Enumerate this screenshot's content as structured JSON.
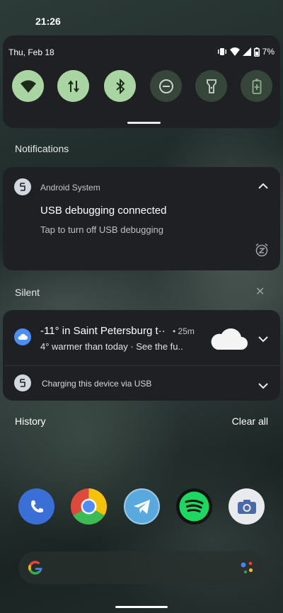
{
  "status_bar": {
    "time": "21:26"
  },
  "quick_settings": {
    "date": "Thu, Feb 18",
    "battery": "7%",
    "tiles": [
      {
        "name": "wifi",
        "state": "on"
      },
      {
        "name": "mobile-data",
        "state": "on"
      },
      {
        "name": "bluetooth",
        "state": "on"
      },
      {
        "name": "do-not-disturb",
        "state": "off"
      },
      {
        "name": "flashlight",
        "state": "off"
      },
      {
        "name": "battery-saver",
        "state": "off"
      }
    ]
  },
  "notifications": {
    "header": "Notifications",
    "android_system": {
      "app": "Android System",
      "title": "USB debugging connected",
      "text": "Tap to turn off USB debugging"
    }
  },
  "silent": {
    "header": "Silent",
    "weather": {
      "title": "-11° in Saint Petersburg t··",
      "time": "• 25m",
      "text": "4° warmer than today · See the fu.."
    },
    "charging": {
      "text": "Charging this device via USB"
    }
  },
  "history": {
    "label": "History",
    "clear_all": "Clear all"
  },
  "dock": [
    "phone",
    "chrome",
    "telegram",
    "spotify",
    "camera"
  ],
  "colors": {
    "tile_on": "#a8d5a2",
    "tile_off": "#37463a",
    "card": "#1f2023",
    "weather_accent": "#4c8df6"
  }
}
